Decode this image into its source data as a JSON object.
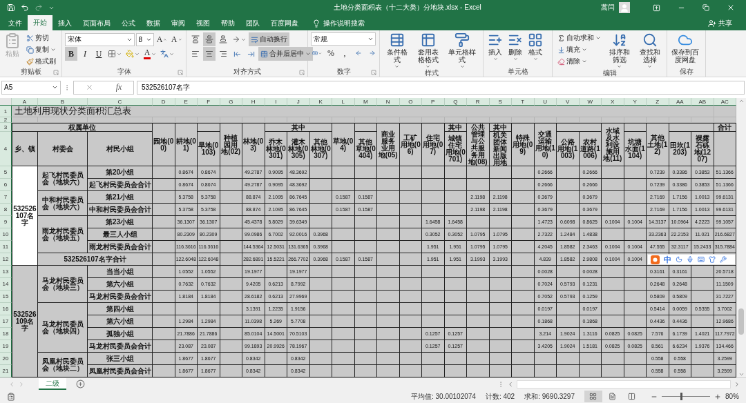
{
  "title_bar": {
    "title": "土地分类面积表（十二大类）分地块.xlsx  -  Excel",
    "user": "蒿闫"
  },
  "menu_tabs": [
    {
      "label": "文件",
      "selected": false
    },
    {
      "label": "开始",
      "selected": true
    },
    {
      "label": "插入",
      "selected": false
    },
    {
      "label": "页面布局",
      "selected": false
    },
    {
      "label": "公式",
      "selected": false
    },
    {
      "label": "数据",
      "selected": false
    },
    {
      "label": "审阅",
      "selected": false
    },
    {
      "label": "视图",
      "selected": false
    },
    {
      "label": "帮助",
      "selected": false
    },
    {
      "label": "团队",
      "selected": false
    },
    {
      "label": "百度网盘",
      "selected": false
    }
  ],
  "tell_me": "操作说明搜索",
  "share": "共享",
  "ribbon": {
    "clipboard": {
      "title": "剪贴板",
      "paste": {
        "label": "粘贴",
        "disabled": true
      },
      "cut": "剪切",
      "copy": "复制",
      "format_painter": "格式刷"
    },
    "font": {
      "title": "字体",
      "font_name": "宋体",
      "font_size": "8",
      "grow": "A",
      "shrink": "A",
      "styles": [
        {
          "kind": "bold",
          "label": "B",
          "on": true
        },
        {
          "kind": "italic",
          "label": "I",
          "on": false
        },
        {
          "kind": "underline",
          "label": "U",
          "on": false
        }
      ],
      "font_color": "A"
    },
    "alignment": {
      "title": "对齐方式",
      "vertical_align": [
        {
          "kind": "top",
          "selected": false
        },
        {
          "kind": "middle",
          "selected": true
        },
        {
          "kind": "bottom",
          "selected": false
        }
      ],
      "horizontal_align": [
        {
          "kind": "left",
          "selected": false
        },
        {
          "kind": "center",
          "selected": true
        },
        {
          "kind": "right",
          "selected": false
        }
      ],
      "wrap_text": {
        "label": "自动换行",
        "on": true
      },
      "merge_center": {
        "label": "合并后居中",
        "on": true
      }
    },
    "number": {
      "title": "数字",
      "format": "常规",
      "percent": "%",
      "comma": ","
    },
    "styles": {
      "title": "样式",
      "buttons": [
        "条件格式",
        "套用表格格式",
        "单元格样式"
      ]
    },
    "cells": {
      "title": "单元格",
      "buttons": [
        "插入",
        "删除",
        "格式"
      ]
    },
    "editing": {
      "title": "编辑",
      "autosum": "自动求和",
      "fill": "填充",
      "clear": "清除",
      "sort": "排序和筛选",
      "find": "查找和选择"
    },
    "save": {
      "title": "保存",
      "button": "保存到百度网盘"
    }
  },
  "formula_bar": {
    "name_box": "A5",
    "fx": "fx",
    "formula": "532526107名字"
  },
  "sheet": {
    "columns": [
      "A",
      "B",
      "C",
      "D",
      "E",
      "F",
      "G",
      "H",
      "I",
      "J",
      "K",
      "L",
      "M",
      "N",
      "O",
      "P",
      "Q",
      "R",
      "S",
      "T",
      "U",
      "V",
      "W",
      "X",
      "Y",
      "Z",
      "AA",
      "AB",
      "AC"
    ],
    "rows": [
      {
        "number": "1",
        "cells": [
          "土地利用现状分类面积汇总表",
          null,
          null,
          null,
          null,
          null,
          null,
          null,
          null,
          null,
          null,
          null,
          null,
          null,
          null,
          null,
          null,
          null,
          null,
          null,
          null,
          null,
          null,
          null,
          null,
          null,
          null,
          null,
          null
        ]
      },
      {
        "number": "2"
      },
      {
        "number": "3",
        "cells": [
          "权属单位",
          null,
          null,
          "园地(00)",
          "耕地(01)",
          null,
          "种植园用地(02)",
          "林地(03)",
          "其中",
          null,
          null,
          "草地(04)",
          null,
          "商业服务业用地(05)",
          "工矿用地(06)",
          "住宅用地(07)",
          "其中",
          "公共管理与公共服务用地(08)",
          "其中",
          "特殊用地(09)",
          "交通运输用地(10)",
          null,
          null,
          "水域及水利设施用地(11)",
          null,
          "其他土地(12)",
          null,
          null,
          "合计"
        ]
      },
      {
        "number": "4",
        "cells": [
          "乡、镇",
          "村委会",
          "村民小组",
          null,
          null,
          "旱地(0103)",
          null,
          null,
          "乔木林地(0301)",
          "灌木林地(0305)",
          "其他林地(0307)",
          null,
          "其他草地(0404)",
          null,
          null,
          null,
          "城镇住宅用地(0701)",
          null,
          "机关团体新闻出版用地",
          null,
          null,
          "公路用地(1003)",
          "农村道路(1006)",
          null,
          "坑塘水面(1104)",
          null,
          "田坎(1203)",
          "裸露石砾地(1207)",
          null
        ]
      },
      {
        "number": "5",
        "cells": [
          {
            "text": "532526107名字",
            "active": true
          },
          "起飞村民委员会（地块六）",
          "第20小组",
          null,
          "0.8674",
          "0.8674",
          null,
          "49.2787",
          "0.9095",
          "48.3692",
          null,
          null,
          null,
          null,
          null,
          null,
          null,
          null,
          null,
          null,
          "0.2666",
          null,
          "0.2666",
          null,
          null,
          "0.7239",
          "0.3386",
          "0.3853",
          "51.1366"
        ]
      },
      {
        "number": "6",
        "cells": [
          null,
          null,
          "起飞村民委员会合计",
          null,
          "0.8674",
          "0.8674",
          null,
          "49.2787",
          "0.9095",
          "48.3692",
          null,
          null,
          null,
          null,
          null,
          null,
          null,
          null,
          null,
          null,
          "0.2666",
          null,
          "0.2666",
          null,
          null,
          "0.7239",
          "0.3386",
          "0.3853",
          "51.1366"
        ]
      },
      {
        "number": "7",
        "cells": [
          null,
          "中和村民委员会（地块六）",
          "第21小组",
          null,
          "5.3758",
          "5.3758",
          null,
          "88.874",
          "2.1095",
          "86.7645",
          null,
          "0.1587",
          "0.1587",
          null,
          null,
          null,
          null,
          "2.1198",
          "2.1198",
          null,
          "0.3679",
          null,
          "0.3679",
          null,
          null,
          "2.7169",
          "1.7156",
          "1.0013",
          "99.6131"
        ]
      },
      {
        "number": "8",
        "cells": [
          null,
          null,
          "中和村民委员会合计",
          null,
          "5.3758",
          "5.3758",
          null,
          "88.874",
          "2.1095",
          "86.7645",
          null,
          "0.1587",
          "0.1587",
          null,
          null,
          null,
          null,
          "2.1198",
          "2.1198",
          null,
          "0.3679",
          null,
          "0.3679",
          null,
          null,
          "2.7169",
          "1.7156",
          "1.0013",
          "99.6131"
        ]
      },
      {
        "number": "9",
        "cells": [
          null,
          "雨龙村民委员会（地块五）",
          "第23小组",
          null,
          "36.1307",
          "36.1307",
          null,
          "45.4378",
          "5.8029",
          "39.6349",
          null,
          null,
          null,
          null,
          null,
          "1.6458",
          "1.6458",
          null,
          null,
          null,
          "1.4723",
          "0.6098",
          "0.8625",
          "0.1004",
          "0.1004",
          "14.3137",
          "10.0964",
          "4.2223",
          "99.1057"
        ]
      },
      {
        "number": "10",
        "cells": [
          null,
          null,
          "最三人小组",
          null,
          "80.2309",
          "80.2309",
          null,
          "99.0986",
          "6.7002",
          "92.0016",
          "0.3968",
          null,
          null,
          null,
          null,
          "0.3052",
          "0.3052",
          "1.0795",
          "1.0795",
          null,
          "2.7322",
          "1.2484",
          "1.4838",
          null,
          null,
          "33.2363",
          "22.2153",
          "11.021",
          "216.6827"
        ]
      },
      {
        "number": "11",
        "cells": [
          null,
          null,
          "雨龙村民委员会合计",
          null,
          "116.3616",
          "116.3616",
          null,
          "144.5364",
          "12.5031",
          "131.6365",
          "0.3968",
          null,
          null,
          null,
          null,
          "1.951",
          "1.951",
          "1.0795",
          "1.0795",
          null,
          "4.2045",
          "1.8582",
          "2.3463",
          "0.1004",
          "0.1004",
          "47.555",
          "32.3117",
          "15.2433",
          "315.7884"
        ]
      },
      {
        "number": "12",
        "cells": [
          null,
          "532526107名字合计",
          null,
          null,
          "122.6048",
          "122.6048",
          null,
          "282.6891",
          "15.5221",
          "266.7702",
          "0.3968",
          "0.1587",
          "0.1587",
          null,
          null,
          "1.951",
          "1.951",
          "3.1993",
          "3.1993",
          null,
          "4.839",
          "1.8582",
          "2.9808",
          "0.1004",
          "0.1004",
          null,
          null,
          null,
          null
        ]
      },
      {
        "number": "13",
        "cells": [
          "532526109名字",
          "马龙村民委员会（地块三）",
          "当当小组",
          null,
          "1.0552",
          "1.0552",
          null,
          "19.1977",
          null,
          "19.1977",
          null,
          null,
          null,
          null,
          null,
          null,
          null,
          null,
          null,
          null,
          "0.0028",
          null,
          "0.0028",
          null,
          null,
          "0.3161",
          "0.3161",
          null,
          "20.5718"
        ]
      },
      {
        "number": "14",
        "cells": [
          null,
          null,
          "第六小组",
          null,
          "0.7632",
          "0.7632",
          null,
          "9.4205",
          "0.6213",
          "8.7992",
          null,
          null,
          null,
          null,
          null,
          null,
          null,
          null,
          null,
          null,
          "0.7024",
          "0.5793",
          "0.1231",
          null,
          null,
          "0.2648",
          "0.2648",
          null,
          "11.1509"
        ]
      },
      {
        "number": "15",
        "cells": [
          null,
          null,
          "马龙村民委员会合计",
          null,
          "1.8184",
          "1.8184",
          null,
          "28.6182",
          "0.6213",
          "27.9969",
          null,
          null,
          null,
          null,
          null,
          null,
          null,
          null,
          null,
          null,
          "0.7052",
          "0.5793",
          "0.1259",
          null,
          null,
          "0.5809",
          "0.5809",
          null,
          "31.7227"
        ]
      },
      {
        "number": "16",
        "cells": [
          null,
          "马龙村民委员会（地块四）",
          "第四小组",
          null,
          null,
          null,
          null,
          "3.1391",
          "1.2235",
          "1.9156",
          null,
          null,
          null,
          null,
          null,
          null,
          null,
          null,
          null,
          null,
          "0.0197",
          null,
          "0.0197",
          null,
          null,
          "0.5414",
          "0.0059",
          "0.5355",
          "3.7002"
        ]
      },
      {
        "number": "17",
        "cells": [
          null,
          null,
          "第六小组",
          null,
          "1.2984",
          "1.2984",
          null,
          "11.0398",
          "5.269",
          "5.7708",
          null,
          null,
          null,
          null,
          null,
          null,
          null,
          null,
          null,
          null,
          "0.1868",
          null,
          "0.1868",
          null,
          null,
          "0.4436",
          "0.4436",
          null,
          "12.9686"
        ]
      },
      {
        "number": "18",
        "cells": [
          null,
          null,
          "孤独小组",
          null,
          "21.7886",
          "21.7886",
          null,
          "85.0104",
          "14.5001",
          "70.5103",
          null,
          null,
          null,
          null,
          null,
          "0.1257",
          "0.1257",
          null,
          null,
          null,
          "3.214",
          "1.9024",
          "1.3116",
          "0.0825",
          "0.0825",
          "7.576",
          "6.1739",
          "1.4021",
          "117.7972"
        ]
      },
      {
        "number": "19",
        "cells": [
          null,
          null,
          "马龙村民委员会合计",
          null,
          "23.087",
          "23.087",
          null,
          "99.1893",
          "20.9926",
          "78.1967",
          null,
          null,
          null,
          null,
          null,
          "0.1257",
          "0.1257",
          null,
          null,
          null,
          "3.4205",
          "1.9024",
          "1.5181",
          "0.0825",
          "0.0825",
          "8.561",
          "6.6234",
          "1.9376",
          "134.466"
        ]
      },
      {
        "number": "20",
        "cells": [
          null,
          "凤凰村民委员会（地块二）",
          "张三小组",
          null,
          "1.8677",
          "1.8677",
          null,
          "0.8342",
          null,
          "0.8342",
          null,
          null,
          null,
          null,
          null,
          null,
          null,
          null,
          null,
          null,
          null,
          null,
          null,
          null,
          null,
          "0.558",
          "0.558",
          null,
          "3.2599"
        ]
      },
      {
        "number": "21",
        "cells": [
          null,
          null,
          "凤凰村民委员会合计",
          null,
          "1.8677",
          "1.8677",
          null,
          "0.8342",
          null,
          "0.8342",
          null,
          null,
          null,
          null,
          null,
          null,
          null,
          null,
          null,
          null,
          null,
          null,
          null,
          null,
          null,
          "0.558",
          "0.558",
          null,
          "3.2599"
        ]
      }
    ]
  },
  "ime_bar": {
    "label": "中"
  },
  "sheet_tabs": [
    {
      "label": "二级",
      "selected": true
    }
  ],
  "status_bar": {
    "average": "平均值: 30.00102074",
    "count": "计数: 402",
    "sum": "求和: 9690.3297",
    "views": [
      {
        "kind": "normal",
        "selected": true
      },
      {
        "kind": "page_layout",
        "selected": false
      },
      {
        "kind": "page_break",
        "selected": false
      }
    ],
    "zoom": {
      "level": 0.4,
      "label": "80%"
    }
  }
}
